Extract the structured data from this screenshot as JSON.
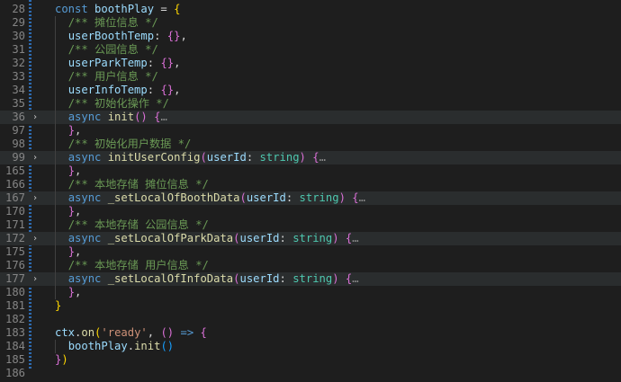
{
  "editor": {
    "lines": [
      {
        "n": "28",
        "tokens": [
          [
            "kw",
            "const"
          ],
          [
            "p",
            " "
          ],
          [
            "var",
            "boothPlay"
          ],
          [
            "p",
            " = "
          ],
          [
            "br1",
            "{"
          ]
        ]
      },
      {
        "n": "29",
        "tokens": [
          [
            "p",
            "  "
          ],
          [
            "cmt",
            "/** 摊位信息 */"
          ]
        ]
      },
      {
        "n": "30",
        "tokens": [
          [
            "p",
            "  "
          ],
          [
            "var",
            "userBoothTemp"
          ],
          [
            "p",
            ": "
          ],
          [
            "br2",
            "{}"
          ],
          [
            "p",
            ","
          ]
        ]
      },
      {
        "n": "31",
        "tokens": [
          [
            "p",
            "  "
          ],
          [
            "cmt",
            "/** 公园信息 */"
          ]
        ]
      },
      {
        "n": "32",
        "tokens": [
          [
            "p",
            "  "
          ],
          [
            "var",
            "userParkTemp"
          ],
          [
            "p",
            ": "
          ],
          [
            "br2",
            "{}"
          ],
          [
            "p",
            ","
          ]
        ]
      },
      {
        "n": "33",
        "tokens": [
          [
            "p",
            "  "
          ],
          [
            "cmt",
            "/** 用户信息 */"
          ]
        ]
      },
      {
        "n": "34",
        "tokens": [
          [
            "p",
            "  "
          ],
          [
            "var",
            "userInfoTemp"
          ],
          [
            "p",
            ": "
          ],
          [
            "br2",
            "{}"
          ],
          [
            "p",
            ","
          ]
        ]
      },
      {
        "n": "35",
        "tokens": [
          [
            "p",
            "  "
          ],
          [
            "cmt",
            "/** 初始化操作 */"
          ]
        ]
      },
      {
        "n": "36",
        "folded": true,
        "tokens": [
          [
            "p",
            "  "
          ],
          [
            "kw",
            "async"
          ],
          [
            "p",
            " "
          ],
          [
            "fn",
            "init"
          ],
          [
            "br2",
            "()"
          ],
          [
            "p",
            " "
          ],
          [
            "br2",
            "{"
          ],
          [
            "ell",
            "…"
          ]
        ]
      },
      {
        "n": "97",
        "tokens": [
          [
            "p",
            "  "
          ],
          [
            "br2",
            "}"
          ],
          [
            "p",
            ","
          ]
        ]
      },
      {
        "n": "98",
        "tokens": [
          [
            "p",
            "  "
          ],
          [
            "cmt",
            "/** 初始化用户数据 */"
          ]
        ]
      },
      {
        "n": "99",
        "folded": true,
        "tokens": [
          [
            "p",
            "  "
          ],
          [
            "kw",
            "async"
          ],
          [
            "p",
            " "
          ],
          [
            "fn",
            "initUserConfig"
          ],
          [
            "br2",
            "("
          ],
          [
            "var",
            "userId"
          ],
          [
            "p",
            ": "
          ],
          [
            "ty",
            "string"
          ],
          [
            "br2",
            ")"
          ],
          [
            "p",
            " "
          ],
          [
            "br2",
            "{"
          ],
          [
            "ell",
            "…"
          ]
        ]
      },
      {
        "n": "165",
        "tokens": [
          [
            "p",
            "  "
          ],
          [
            "br2",
            "}"
          ],
          [
            "p",
            ","
          ]
        ]
      },
      {
        "n": "166",
        "tokens": [
          [
            "p",
            "  "
          ],
          [
            "cmt",
            "/** 本地存储 摊位信息 */"
          ]
        ]
      },
      {
        "n": "167",
        "folded": true,
        "tokens": [
          [
            "p",
            "  "
          ],
          [
            "kw",
            "async"
          ],
          [
            "p",
            " "
          ],
          [
            "fn",
            "_setLocalOfBoothData"
          ],
          [
            "br2",
            "("
          ],
          [
            "var",
            "userId"
          ],
          [
            "p",
            ": "
          ],
          [
            "ty",
            "string"
          ],
          [
            "br2",
            ")"
          ],
          [
            "p",
            " "
          ],
          [
            "br2",
            "{"
          ],
          [
            "ell",
            "…"
          ]
        ]
      },
      {
        "n": "170",
        "tokens": [
          [
            "p",
            "  "
          ],
          [
            "br2",
            "}"
          ],
          [
            "p",
            ","
          ]
        ]
      },
      {
        "n": "171",
        "tokens": [
          [
            "p",
            "  "
          ],
          [
            "cmt",
            "/** 本地存储 公园信息 */"
          ]
        ]
      },
      {
        "n": "172",
        "folded": true,
        "tokens": [
          [
            "p",
            "  "
          ],
          [
            "kw",
            "async"
          ],
          [
            "p",
            " "
          ],
          [
            "fn",
            "_setLocalOfParkData"
          ],
          [
            "br2",
            "("
          ],
          [
            "var",
            "userId"
          ],
          [
            "p",
            ": "
          ],
          [
            "ty",
            "string"
          ],
          [
            "br2",
            ")"
          ],
          [
            "p",
            " "
          ],
          [
            "br2",
            "{"
          ],
          [
            "ell",
            "…"
          ]
        ]
      },
      {
        "n": "175",
        "tokens": [
          [
            "p",
            "  "
          ],
          [
            "br2",
            "}"
          ],
          [
            "p",
            ","
          ]
        ]
      },
      {
        "n": "176",
        "tokens": [
          [
            "p",
            "  "
          ],
          [
            "cmt",
            "/** 本地存储 用户信息 */"
          ]
        ]
      },
      {
        "n": "177",
        "folded": true,
        "tokens": [
          [
            "p",
            "  "
          ],
          [
            "kw",
            "async"
          ],
          [
            "p",
            " "
          ],
          [
            "fn",
            "_setLocalOfInfoData"
          ],
          [
            "br2",
            "("
          ],
          [
            "var",
            "userId"
          ],
          [
            "p",
            ": "
          ],
          [
            "ty",
            "string"
          ],
          [
            "br2",
            ")"
          ],
          [
            "p",
            " "
          ],
          [
            "br2",
            "{"
          ],
          [
            "ell",
            "…"
          ]
        ]
      },
      {
        "n": "180",
        "tokens": [
          [
            "p",
            "  "
          ],
          [
            "br2",
            "}"
          ],
          [
            "p",
            ","
          ]
        ]
      },
      {
        "n": "181",
        "tokens": [
          [
            "br1",
            "}"
          ]
        ]
      },
      {
        "n": "182",
        "tokens": []
      },
      {
        "n": "183",
        "tokens": [
          [
            "var",
            "ctx"
          ],
          [
            "p",
            "."
          ],
          [
            "fn",
            "on"
          ],
          [
            "br1",
            "("
          ],
          [
            "str",
            "'ready'"
          ],
          [
            "p",
            ", "
          ],
          [
            "br2",
            "()"
          ],
          [
            "p",
            " "
          ],
          [
            "kw",
            "=>"
          ],
          [
            "p",
            " "
          ],
          [
            "br2",
            "{"
          ]
        ]
      },
      {
        "n": "184",
        "tokens": [
          [
            "p",
            "  "
          ],
          [
            "var",
            "boothPlay"
          ],
          [
            "p",
            "."
          ],
          [
            "fn",
            "init"
          ],
          [
            "br3",
            "()"
          ]
        ]
      },
      {
        "n": "185",
        "tokens": [
          [
            "br2",
            "}"
          ],
          [
            "br1",
            ")"
          ]
        ]
      },
      {
        "n": "186",
        "tokens": []
      }
    ],
    "fold_glyph": "›",
    "colors": {
      "background": "#1e1e1e",
      "keyword": "#569cd6",
      "function": "#dcdcaa",
      "variable": "#9cdcfe",
      "comment": "#6a9955",
      "string": "#ce9178",
      "type": "#4ec9b0",
      "folded_line_bg": "#2a2d2e"
    }
  }
}
